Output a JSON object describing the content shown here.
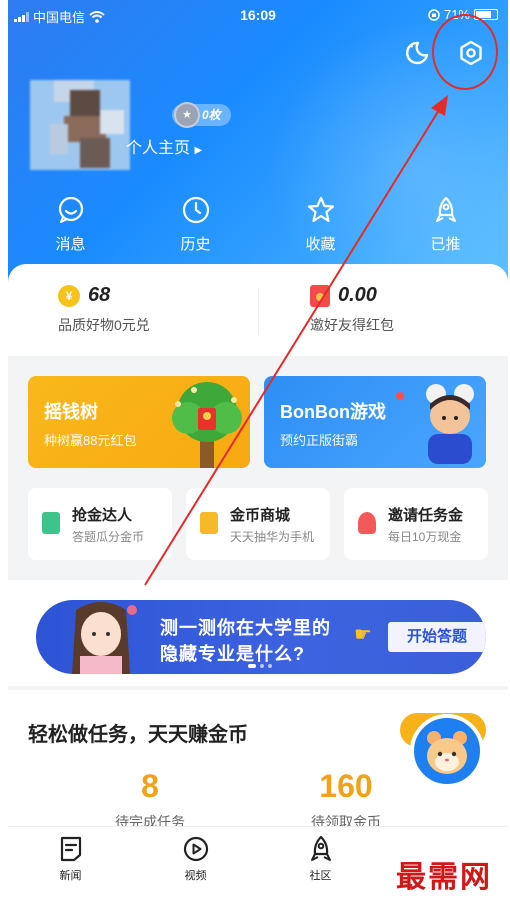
{
  "status_bar": {
    "carrier": "中国电信",
    "time": "16:09",
    "battery": "71%"
  },
  "profile": {
    "coin_badge": "0枚",
    "homepage_link": "个人主页"
  },
  "quick_nav": [
    {
      "label": "消息",
      "icon": "message-icon"
    },
    {
      "label": "历史",
      "icon": "clock-icon"
    },
    {
      "label": "收藏",
      "icon": "star-icon"
    },
    {
      "label": "已推",
      "icon": "rocket-icon"
    }
  ],
  "stats": [
    {
      "value": "68",
      "label": "品质好物0元兑"
    },
    {
      "value": "0.00",
      "label": "邀好友得红包"
    }
  ],
  "promos": [
    {
      "title": "摇钱树",
      "subtitle": "种树赢88元红包"
    },
    {
      "title": "BonBon游戏",
      "subtitle": "预约正版街霸"
    }
  ],
  "mini_cards": [
    {
      "title": "抢金达人",
      "subtitle": "答题瓜分金币",
      "color": "#3cc48c"
    },
    {
      "title": "金币商城",
      "subtitle": "天天抽华为手机",
      "color": "#f6b927"
    },
    {
      "title": "邀请任务金",
      "subtitle": "每日10万现金",
      "color": "#f25a5a"
    }
  ],
  "banner": {
    "line1": "测一测你在大学里的",
    "line2": "隐藏专业是什么?",
    "cta": "开始答题"
  },
  "tasks": {
    "title": "轻松做任务，天天赚金币",
    "items": [
      {
        "value": "8",
        "label": "待完成任务"
      },
      {
        "value": "160",
        "label": "待领取金币"
      }
    ]
  },
  "tabbar": [
    {
      "label": "新闻",
      "icon": "news-icon"
    },
    {
      "label": "视频",
      "icon": "play-icon"
    },
    {
      "label": "社区",
      "icon": "rocket-icon"
    }
  ],
  "watermark": "最需网",
  "colors": {
    "brand": "#1a8bff",
    "accent_gold": "#f0a21a",
    "annotation": "#e52a2a"
  }
}
